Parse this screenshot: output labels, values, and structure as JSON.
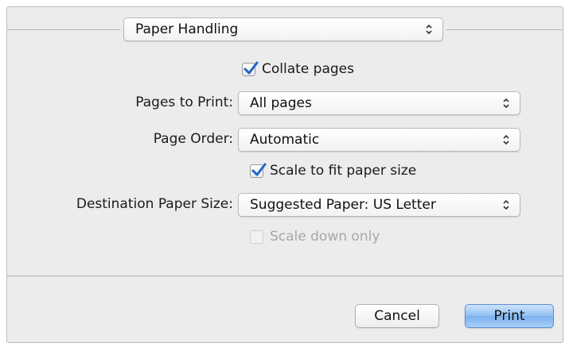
{
  "section": {
    "selected": "Paper Handling"
  },
  "collate": {
    "label": "Collate pages",
    "checked": true
  },
  "pages_to_print": {
    "label": "Pages to Print:",
    "value": "All pages"
  },
  "page_order": {
    "label": "Page Order:",
    "value": "Automatic"
  },
  "scale_to_fit": {
    "label": "Scale to fit paper size",
    "checked": true
  },
  "destination_paper_size": {
    "label": "Destination Paper Size:",
    "value": "Suggested Paper: US Letter"
  },
  "scale_down_only": {
    "label": "Scale down only",
    "checked": false,
    "enabled": false
  },
  "buttons": {
    "cancel": "Cancel",
    "print": "Print"
  },
  "colors": {
    "checkmark": "#1f66c9",
    "dialog_background": "#ececec",
    "default_button": "#7ab0ee"
  },
  "icons": {
    "popup_arrows": "up-down-chevron-icon",
    "checkmark": "checkmark-icon"
  }
}
